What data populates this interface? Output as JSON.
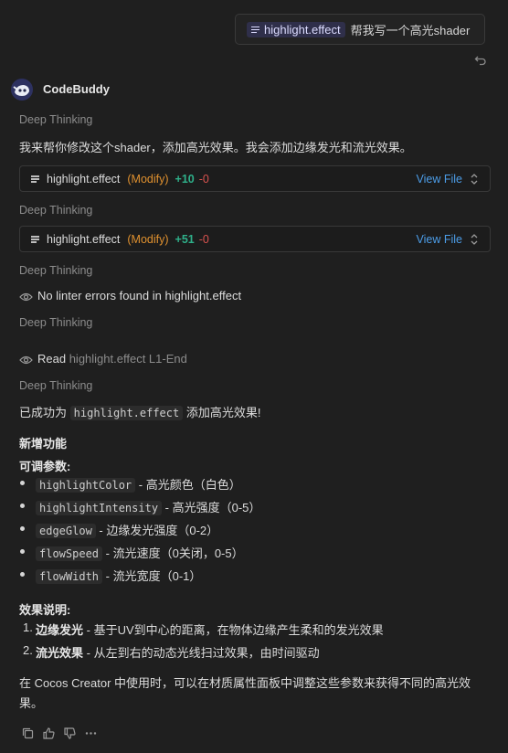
{
  "user_message": {
    "file_chip": "highlight.effect",
    "text": "帮我写一个高光shader"
  },
  "assistant": {
    "name": "CodeBuddy",
    "thinking_label": "Deep Thinking",
    "intro": "我来帮你修改这个shader，添加高光效果。我会添加边缘发光和流光效果。",
    "edits": [
      {
        "file": "highlight.effect",
        "action": "(Modify)",
        "added": "+10",
        "removed": "-0",
        "view": "View File"
      },
      {
        "file": "highlight.effect",
        "action": "(Modify)",
        "added": "+51",
        "removed": "-0",
        "view": "View File"
      }
    ],
    "linter": "No linter errors found in highlight.effect",
    "read_label": "Read",
    "read_target": "highlight.effect L1-End",
    "success_pre": "已成功为",
    "success_code": "highlight.effect",
    "success_post": "添加高光效果!",
    "new_features_heading": "新增功能",
    "params_heading": "可调参数:",
    "params": [
      {
        "name": "highlightColor",
        "desc": "- 高光颜色（白色）"
      },
      {
        "name": "highlightIntensity",
        "desc": "- 高光强度（0-5）"
      },
      {
        "name": "edgeGlow",
        "desc": "- 边缘发光强度（0-2）"
      },
      {
        "name": "flowSpeed",
        "desc": "- 流光速度（0关闭，0-5）"
      },
      {
        "name": "flowWidth",
        "desc": "- 流光宽度（0-1）"
      }
    ],
    "effects_heading": "效果说明:",
    "effects": [
      {
        "num": "1.",
        "title": "边缘发光",
        "desc": "- 基于UV到中心的距离，在物体边缘产生柔和的发光效果"
      },
      {
        "num": "2.",
        "title": "流光效果",
        "desc": "- 从左到右的动态光线扫过效果，由时间驱动"
      }
    ],
    "closing": "在 Cocos Creator 中使用时，可以在材质属性面板中调整这些参数来获得不同的高光效果。"
  },
  "colors": {
    "background": "#1f1f1f",
    "accent_link": "#4c9de8",
    "modify": "#e0912f",
    "added": "#2fb08a",
    "removed": "#d9534f"
  },
  "icons": [
    "file-icon",
    "undo-icon",
    "eye-icon",
    "chevron-updown-icon",
    "copy-icon",
    "thumbs-up-icon",
    "thumbs-down-icon",
    "more-icon"
  ]
}
